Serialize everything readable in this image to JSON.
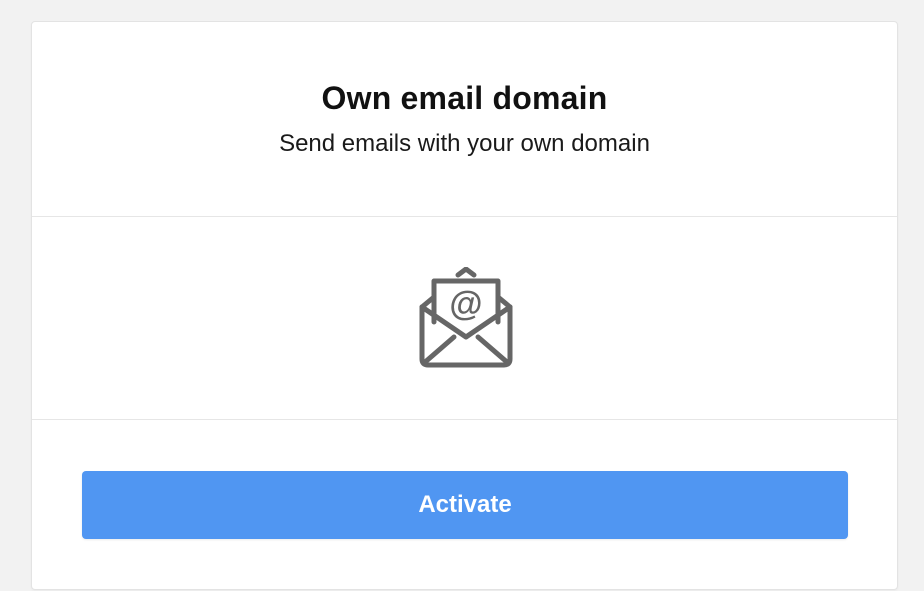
{
  "card": {
    "title": "Own email domain",
    "subtitle": "Send emails with your own domain",
    "icon": "envelope-at-icon",
    "activate_label": "Activate"
  },
  "colors": {
    "accent": "#5096f2",
    "icon": "#666666"
  }
}
